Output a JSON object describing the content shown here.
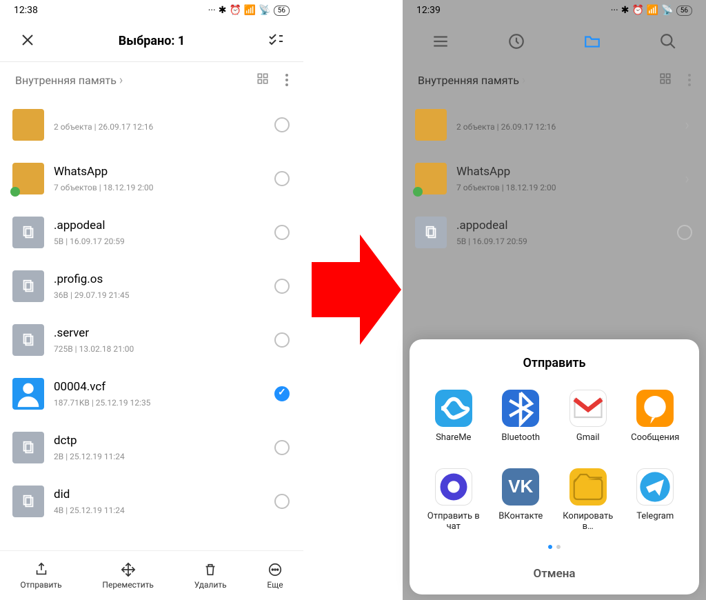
{
  "left": {
    "time": "12:38",
    "battery": "56",
    "header_title": "Выбрано: 1",
    "breadcrumb": "Внутренняя память",
    "rows": [
      {
        "type": "folder",
        "name": "",
        "meta": "2 объекта  |  26.09.17 12:16",
        "selected": false,
        "wa": false
      },
      {
        "type": "folder",
        "name": "WhatsApp",
        "meta": "7 объектов  |  18.12.19 2:00",
        "selected": false,
        "wa": true
      },
      {
        "type": "file",
        "name": ".appodeal",
        "meta": "5B  |  16.09.17 20:59",
        "selected": false
      },
      {
        "type": "file",
        "name": ".profig.os",
        "meta": "36B  |  29.07.19 21:45",
        "selected": false
      },
      {
        "type": "file",
        "name": ".server",
        "meta": "725B  |  13.02.18 21:00",
        "selected": false
      },
      {
        "type": "person",
        "name": "00004.vcf",
        "meta": "187.71KB  |  25.12.19 12:35",
        "selected": true
      },
      {
        "type": "file",
        "name": "dctp",
        "meta": "2B  |  25.12.19 11:24",
        "selected": false
      },
      {
        "type": "file",
        "name": "did",
        "meta": "4B  |  25.12.19 11:24",
        "selected": false
      }
    ],
    "actions": {
      "send": "Отправить",
      "move": "Переместить",
      "delete": "Удалить",
      "more": "Еще"
    }
  },
  "right": {
    "time": "12:39",
    "battery": "56",
    "breadcrumb": "Внутренняя память",
    "rows": [
      {
        "type": "folder",
        "name": "",
        "meta": "2 объекта  |  26.09.17 12:16",
        "wa": false
      },
      {
        "type": "folder",
        "name": "WhatsApp",
        "meta": "7 объектов  |  18.12.19 2:00",
        "wa": true
      },
      {
        "type": "file",
        "name": ".appodeal",
        "meta": "5B  |  16.09.17 20:59"
      }
    ],
    "sheet": {
      "title": "Отправить",
      "apps": [
        {
          "id": "shareme",
          "label": "ShareMe"
        },
        {
          "id": "bluetooth",
          "label": "Bluetooth"
        },
        {
          "id": "gmail",
          "label": "Gmail"
        },
        {
          "id": "messages",
          "label": "Сообщения"
        },
        {
          "id": "sendchat",
          "label": "Отправить в чат"
        },
        {
          "id": "vk",
          "label": "ВКонтакте"
        },
        {
          "id": "copy",
          "label": "Копировать в…"
        },
        {
          "id": "telegram",
          "label": "Telegram"
        }
      ],
      "cancel": "Отмена"
    }
  }
}
